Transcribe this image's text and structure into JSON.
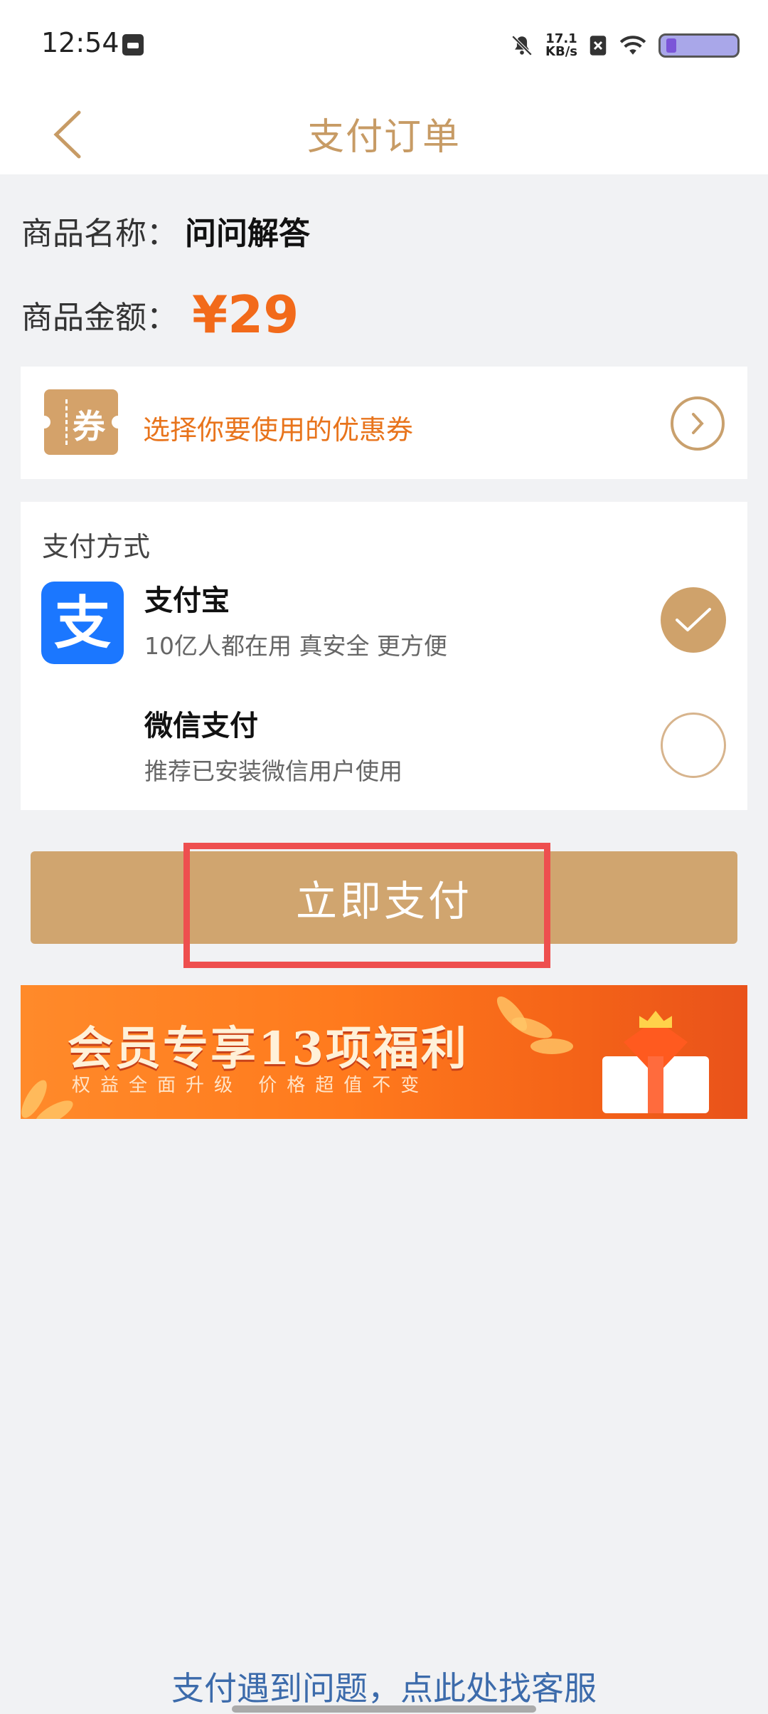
{
  "status_bar": {
    "time": "12:54",
    "net_speed_value": "17.1",
    "net_speed_unit": "KB/s"
  },
  "header": {
    "title": "支付订单"
  },
  "product": {
    "name_label": "商品名称：",
    "name_value": "问问解答",
    "price_label": "商品金额：",
    "price_value": "¥29"
  },
  "coupon": {
    "icon_text": "券",
    "text": "选择你要使用的优惠券"
  },
  "payment": {
    "title": "支付方式",
    "options": [
      {
        "name": "支付宝",
        "desc": "10亿人都在用 真安全 更方便",
        "selected": true,
        "logo_char": "支"
      },
      {
        "name": "微信支付",
        "desc": "推荐已安装微信用户使用",
        "selected": false
      }
    ]
  },
  "pay_button": {
    "label": "立即支付"
  },
  "banner": {
    "title": "会员专享13项福利",
    "subtitle": "权益全面升级  价格超值不变"
  },
  "help": {
    "text": "支付遇到问题，点此处找客服"
  },
  "colors": {
    "accent": "#d0a56f",
    "title_gold": "#c79b65",
    "price_orange": "#f26a1a",
    "coupon_orange": "#e8741c",
    "alipay_blue": "#1b77ff",
    "highlight_red": "#ee4f4f",
    "link_blue": "#3c6bab"
  }
}
